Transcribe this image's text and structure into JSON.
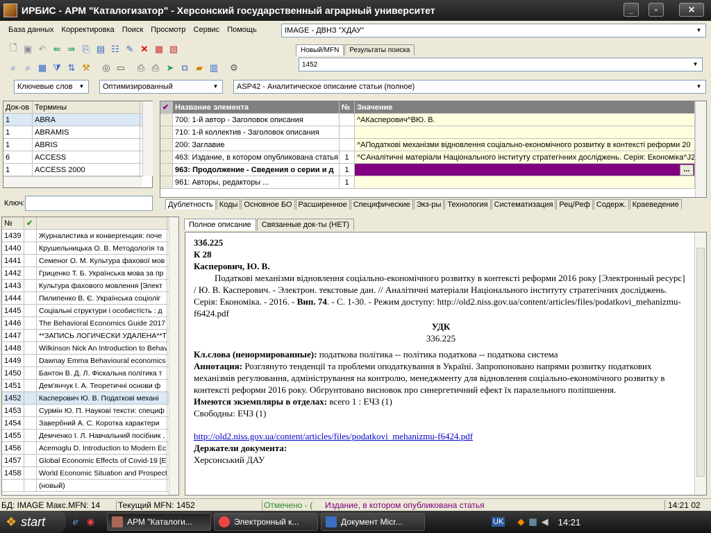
{
  "window": {
    "title": "ИРБИС - АРМ \"Каталогизатор\" - Херсонский государственный аграрный университет"
  },
  "menu": [
    "База данных",
    "Корректировка",
    "Поиск",
    "Просмотр",
    "Сервис",
    "Помощь"
  ],
  "db_select": "IMAGE - ДВНЗ \"ХДАУ\"",
  "search_tabs": [
    "Новый/MFN",
    "Результаты поиска"
  ],
  "mfn_value": "1452",
  "dict_select": "Ключевые слов",
  "mode_select": "Оптимизированный",
  "worksheet_select": "ASP42 - Аналитическое описание статьи (полное)",
  "terms": {
    "headers": [
      "Док-ов",
      "Термины"
    ],
    "rows": [
      {
        "count": "1",
        "term": "ABRA"
      },
      {
        "count": "1",
        "term": "ABRAMIS"
      },
      {
        "count": "1",
        "term": "ABRIS"
      },
      {
        "count": "6",
        "term": "ACCESS"
      },
      {
        "count": "1",
        "term": "ACCESS 2000"
      }
    ],
    "key_label": "Ключ:"
  },
  "fields": {
    "headers": [
      "Название элемента",
      "№",
      "Значение"
    ],
    "rows": [
      {
        "name": "700: 1-й автор - Заголовок описания",
        "num": "",
        "value": "^AКасперович^ВЮ. В."
      },
      {
        "name": "710: 1-й коллектив - Заголовок описания",
        "num": "",
        "value": ""
      },
      {
        "name": "200: Заглавие",
        "num": "",
        "value": "^AПодаткові механізми відновлення соціально-економічного розвитку в контексті реформи 20"
      },
      {
        "name": "463: Издание, в котором опубликована статья",
        "num": "1",
        "value": "^CАналітичні матеріали Національного інституту стратегічних досліджень. Серія: Економіка^J2"
      },
      {
        "name": "963: Продолжение - Сведения о серии и д",
        "num": "1",
        "value": ""
      },
      {
        "name": "961: Авторы, редакторы ...",
        "num": "1",
        "value": ""
      }
    ],
    "ellipsis": "..."
  },
  "field_tabs": [
    "Дублетность",
    "Коды",
    "Основное БО",
    "Расширенное",
    "Специфические",
    "Экз-ры",
    "Технология",
    "Систематизация",
    "Рец/Реф",
    "Содерж.",
    "Краеведение"
  ],
  "records": {
    "header_num": "№",
    "rows": [
      {
        "mfn": "1439",
        "title": "Журналистика и конвергенция: поче"
      },
      {
        "mfn": "1440",
        "title": "Крушельницька О. В. Методологія та"
      },
      {
        "mfn": "1441",
        "title": "Семеног О. М. Культура фахової мов"
      },
      {
        "mfn": "1442",
        "title": "Гриценко Т. Б. Українська мова за пр"
      },
      {
        "mfn": "1443",
        "title": "Культура фахового мовлення [Элект"
      },
      {
        "mfn": "1444",
        "title": "Пилипенко В. Є. Українська соціоліг"
      },
      {
        "mfn": "1445",
        "title": "Соціальні структури і особистість : д"
      },
      {
        "mfn": "1446",
        "title": "The Behavioral Economics Guide 2017"
      },
      {
        "mfn": "1447",
        "title": "**ЗАПИСЬ ЛОГИЧЕСКИ УДАЛЕНА**Т"
      },
      {
        "mfn": "1448",
        "title": "Wilkinson Nick An Introduction to Behav"
      },
      {
        "mfn": "1449",
        "title": "Dawnay Emma Behavioural economics"
      },
      {
        "mfn": "1450",
        "title": "Бантон В. Д. Л. Фіскальна політика т"
      },
      {
        "mfn": "1451",
        "title": "Дем'янчук І. А. Теоретичні основи ф"
      },
      {
        "mfn": "1452",
        "title": "Касперович Ю. В. Податкові механі"
      },
      {
        "mfn": "1453",
        "title": "Сурмін Ю. П. Наукові тексти: специф"
      },
      {
        "mfn": "1454",
        "title": "Завербний А. С. Коротка характери"
      },
      {
        "mfn": "1455",
        "title": "Демченко І. Л. Навчальний посібник ,"
      },
      {
        "mfn": "1456",
        "title": "Acemoglu D. Introduction to Modern Ec"
      },
      {
        "mfn": "1457",
        "title": "Global Economic Effects of Covid-19 [E"
      },
      {
        "mfn": "1458",
        "title": "World Economic Situation and Prospect"
      },
      {
        "mfn": "",
        "title": "(новый)"
      }
    ]
  },
  "desc_tabs": [
    "Полное описание",
    "Связанные док-ты (НЕТ)"
  ],
  "description": {
    "index1": "33б.225",
    "index2": "К 28",
    "author": "Касперович, Ю. В.",
    "body_a": "Податкові механізми відновлення соціально-економічного розвитку в контексті реформи 2016 року [Электронный ресурс] / Ю. В. Касперович. - Электрон. текстовые дан. // Аналітичні матеріали Національного інституту стратегічних досліджень. Серія: Економіка. - 2016. - ",
    "vyp": "Вип. 74",
    "body_b": ". - С. 1-30. - Режим доступу: http://old2.niss.gov.ua/content/articles/files/podatkovi_mehanizmu-f6424.pdf",
    "udk_label": "УДК",
    "udk_value": "336.225",
    "kw_label": "Кл.слова (ненормированные):",
    "kw_value": " податкова політика -- політика податкова -- податкова система",
    "annot_label": "Аннотация:",
    "annot_value": " Розглянуто тенденції та проблеми оподаткування в Україні. Запропоновано напрями розвитку податкових механізмів регулювання, адміністрування на контролю, менеджменту для відновлення соціально-економічного розвитку в контексті реформи 2016 року. Обгрунтовано висновок про синергетичний ефект їх паралельного поліпшення.",
    "copies_label": "Имеются экземпляры в отделах:",
    "copies_value": " всего 1 : ЕЧЗ (1)",
    "free": "Свободны: ЕЧЗ (1)",
    "link": "http://old2.niss.gov.ua/content/articles/files/podatkovi_mehanizmu-f6424.pdf",
    "holders_label": "Держатели документа:",
    "holders_value": "Херсонський ДАУ"
  },
  "status": {
    "db": "БД: IMAGE Макс.MFN: 14",
    "current": "Текущий MFN: 1452",
    "checked": "Отмечено - (",
    "field": "Издание, в котором опубликована статья",
    "time": "14:21  02"
  },
  "taskbar": {
    "start": "start",
    "tasks": [
      "АРМ \"Каталоги...",
      "Электронный к...",
      "Документ Micr..."
    ],
    "lang": "UK",
    "clock": "14:21"
  },
  "colors": {
    "accent_purple": "#800080",
    "selected_row": "#dbe8f5",
    "field_value_bg": "#ffffe0",
    "link": "#0000cc"
  }
}
